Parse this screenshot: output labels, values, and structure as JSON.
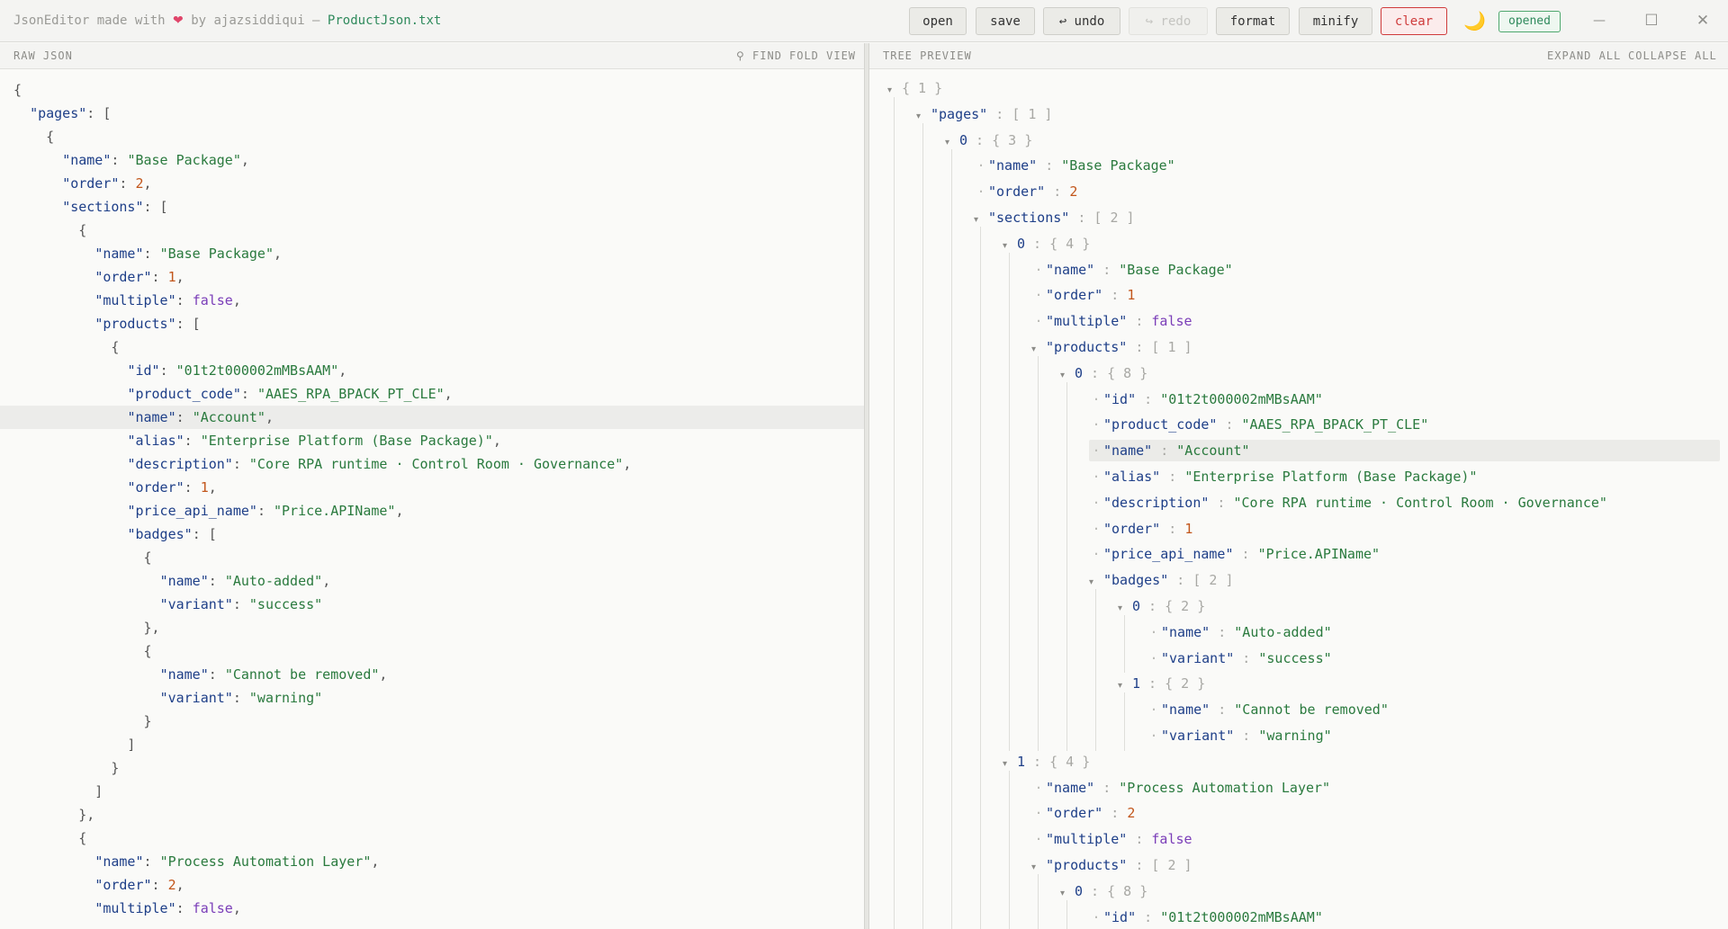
{
  "titlebar": {
    "app": "JsonEditor made with",
    "heart": "❤",
    "by": "by ajazsiddiqui —",
    "file": "ProductJson.txt",
    "buttons": {
      "open": "open",
      "save": "save",
      "undo": "↩ undo",
      "redo": "↪ redo",
      "format": "format",
      "minify": "minify",
      "clear": "clear"
    },
    "theme_icon": "🌙",
    "status": "opened",
    "window": {
      "minimize": "—",
      "maximize": "☐",
      "close": "✕"
    }
  },
  "raw_pane": {
    "label": "RAW JSON",
    "find": "⚲ FIND",
    "fold": "FOLD VIEW",
    "lines": [
      [
        {
          "t": "p",
          "v": "{"
        }
      ],
      [
        {
          "t": "p",
          "v": "  "
        },
        {
          "t": "k",
          "v": "\"pages\""
        },
        {
          "t": "p",
          "v": ": ["
        }
      ],
      [
        {
          "t": "p",
          "v": "    {"
        }
      ],
      [
        {
          "t": "p",
          "v": "      "
        },
        {
          "t": "k",
          "v": "\"name\""
        },
        {
          "t": "p",
          "v": ": "
        },
        {
          "t": "s",
          "v": "\"Base Package\""
        },
        {
          "t": "p",
          "v": ","
        }
      ],
      [
        {
          "t": "p",
          "v": "      "
        },
        {
          "t": "k",
          "v": "\"order\""
        },
        {
          "t": "p",
          "v": ": "
        },
        {
          "t": "n",
          "v": "2"
        },
        {
          "t": "p",
          "v": ","
        }
      ],
      [
        {
          "t": "p",
          "v": "      "
        },
        {
          "t": "k",
          "v": "\"sections\""
        },
        {
          "t": "p",
          "v": ": ["
        }
      ],
      [
        {
          "t": "p",
          "v": "        {"
        }
      ],
      [
        {
          "t": "p",
          "v": "          "
        },
        {
          "t": "k",
          "v": "\"name\""
        },
        {
          "t": "p",
          "v": ": "
        },
        {
          "t": "s",
          "v": "\"Base Package\""
        },
        {
          "t": "p",
          "v": ","
        }
      ],
      [
        {
          "t": "p",
          "v": "          "
        },
        {
          "t": "k",
          "v": "\"order\""
        },
        {
          "t": "p",
          "v": ": "
        },
        {
          "t": "n",
          "v": "1"
        },
        {
          "t": "p",
          "v": ","
        }
      ],
      [
        {
          "t": "p",
          "v": "          "
        },
        {
          "t": "k",
          "v": "\"multiple\""
        },
        {
          "t": "p",
          "v": ": "
        },
        {
          "t": "b",
          "v": "false"
        },
        {
          "t": "p",
          "v": ","
        }
      ],
      [
        {
          "t": "p",
          "v": "          "
        },
        {
          "t": "k",
          "v": "\"products\""
        },
        {
          "t": "p",
          "v": ": ["
        }
      ],
      [
        {
          "t": "p",
          "v": "            {"
        }
      ],
      [
        {
          "t": "p",
          "v": "              "
        },
        {
          "t": "k",
          "v": "\"id\""
        },
        {
          "t": "p",
          "v": ": "
        },
        {
          "t": "s",
          "v": "\"01t2t000002mMBsAAM\""
        },
        {
          "t": "p",
          "v": ","
        }
      ],
      [
        {
          "t": "p",
          "v": "              "
        },
        {
          "t": "k",
          "v": "\"product_code\""
        },
        {
          "t": "p",
          "v": ": "
        },
        {
          "t": "s",
          "v": "\"AAES_RPA_BPACK_PT_CLE\""
        },
        {
          "t": "p",
          "v": ","
        }
      ],
      [
        {
          "t": "p",
          "v": "              "
        },
        {
          "t": "k",
          "v": "\"name\""
        },
        {
          "t": "p",
          "v": ": "
        },
        {
          "t": "s",
          "v": "\"Account\""
        },
        {
          "t": "p",
          "v": ","
        }
      ],
      [
        {
          "t": "p",
          "v": "              "
        },
        {
          "t": "k",
          "v": "\"alias\""
        },
        {
          "t": "p",
          "v": ": "
        },
        {
          "t": "s",
          "v": "\"Enterprise Platform (Base Package)\""
        },
        {
          "t": "p",
          "v": ","
        }
      ],
      [
        {
          "t": "p",
          "v": "              "
        },
        {
          "t": "k",
          "v": "\"description\""
        },
        {
          "t": "p",
          "v": ": "
        },
        {
          "t": "s",
          "v": "\"Core RPA runtime · Control Room · Governance\""
        },
        {
          "t": "p",
          "v": ","
        }
      ],
      [
        {
          "t": "p",
          "v": "              "
        },
        {
          "t": "k",
          "v": "\"order\""
        },
        {
          "t": "p",
          "v": ": "
        },
        {
          "t": "n",
          "v": "1"
        },
        {
          "t": "p",
          "v": ","
        }
      ],
      [
        {
          "t": "p",
          "v": "              "
        },
        {
          "t": "k",
          "v": "\"price_api_name\""
        },
        {
          "t": "p",
          "v": ": "
        },
        {
          "t": "s",
          "v": "\"Price.APIName\""
        },
        {
          "t": "p",
          "v": ","
        }
      ],
      [
        {
          "t": "p",
          "v": "              "
        },
        {
          "t": "k",
          "v": "\"badges\""
        },
        {
          "t": "p",
          "v": ": ["
        }
      ],
      [
        {
          "t": "p",
          "v": "                {"
        }
      ],
      [
        {
          "t": "p",
          "v": "                  "
        },
        {
          "t": "k",
          "v": "\"name\""
        },
        {
          "t": "p",
          "v": ": "
        },
        {
          "t": "s",
          "v": "\"Auto-added\""
        },
        {
          "t": "p",
          "v": ","
        }
      ],
      [
        {
          "t": "p",
          "v": "                  "
        },
        {
          "t": "k",
          "v": "\"variant\""
        },
        {
          "t": "p",
          "v": ": "
        },
        {
          "t": "s",
          "v": "\"success\""
        }
      ],
      [
        {
          "t": "p",
          "v": "                },"
        }
      ],
      [
        {
          "t": "p",
          "v": "                {"
        }
      ],
      [
        {
          "t": "p",
          "v": "                  "
        },
        {
          "t": "k",
          "v": "\"name\""
        },
        {
          "t": "p",
          "v": ": "
        },
        {
          "t": "s",
          "v": "\"Cannot be removed\""
        },
        {
          "t": "p",
          "v": ","
        }
      ],
      [
        {
          "t": "p",
          "v": "                  "
        },
        {
          "t": "k",
          "v": "\"variant\""
        },
        {
          "t": "p",
          "v": ": "
        },
        {
          "t": "s",
          "v": "\"warning\""
        }
      ],
      [
        {
          "t": "p",
          "v": "                }"
        }
      ],
      [
        {
          "t": "p",
          "v": "              ]"
        }
      ],
      [
        {
          "t": "p",
          "v": "            }"
        }
      ],
      [
        {
          "t": "p",
          "v": "          ]"
        }
      ],
      [
        {
          "t": "p",
          "v": "        },"
        }
      ],
      [
        {
          "t": "p",
          "v": "        {"
        }
      ],
      [
        {
          "t": "p",
          "v": "          "
        },
        {
          "t": "k",
          "v": "\"name\""
        },
        {
          "t": "p",
          "v": ": "
        },
        {
          "t": "s",
          "v": "\"Process Automation Layer\""
        },
        {
          "t": "p",
          "v": ","
        }
      ],
      [
        {
          "t": "p",
          "v": "          "
        },
        {
          "t": "k",
          "v": "\"order\""
        },
        {
          "t": "p",
          "v": ": "
        },
        {
          "t": "n",
          "v": "2"
        },
        {
          "t": "p",
          "v": ","
        }
      ],
      [
        {
          "t": "p",
          "v": "          "
        },
        {
          "t": "k",
          "v": "\"multiple\""
        },
        {
          "t": "p",
          "v": ": "
        },
        {
          "t": "b",
          "v": "false"
        },
        {
          "t": "p",
          "v": ","
        }
      ]
    ]
  },
  "tree_pane": {
    "label": "TREE PREVIEW",
    "expand": "EXPAND ALL",
    "collapse": "COLLAPSE ALL",
    "nodes": [
      {
        "d": 0,
        "c": true,
        "meta": "{ 1 }"
      },
      {
        "d": 1,
        "c": true,
        "key": "\"pages\"",
        "meta": "[ 1 ]"
      },
      {
        "d": 2,
        "c": true,
        "idx": "0",
        "meta": "{ 3 }"
      },
      {
        "d": 3,
        "key": "\"name\"",
        "val": "\"Base Package\"",
        "t": "s"
      },
      {
        "d": 3,
        "key": "\"order\"",
        "val": "2",
        "t": "n"
      },
      {
        "d": 3,
        "c": true,
        "key": "\"sections\"",
        "meta": "[ 2 ]"
      },
      {
        "d": 4,
        "c": true,
        "idx": "0",
        "meta": "{ 4 }"
      },
      {
        "d": 5,
        "key": "\"name\"",
        "val": "\"Base Package\"",
        "t": "s"
      },
      {
        "d": 5,
        "key": "\"order\"",
        "val": "1",
        "t": "n"
      },
      {
        "d": 5,
        "key": "\"multiple\"",
        "val": "false",
        "t": "b"
      },
      {
        "d": 5,
        "c": true,
        "key": "\"products\"",
        "meta": "[ 1 ]"
      },
      {
        "d": 6,
        "c": true,
        "idx": "0",
        "meta": "{ 8 }"
      },
      {
        "d": 7,
        "key": "\"id\"",
        "val": "\"01t2t000002mMBsAAM\"",
        "t": "s"
      },
      {
        "d": 7,
        "key": "\"product_code\"",
        "val": "\"AAES_RPA_BPACK_PT_CLE\"",
        "t": "s"
      },
      {
        "d": 7,
        "key": "\"name\"",
        "val": "\"Account\"",
        "t": "s",
        "hl": true
      },
      {
        "d": 7,
        "key": "\"alias\"",
        "val": "\"Enterprise Platform (Base Package)\"",
        "t": "s"
      },
      {
        "d": 7,
        "key": "\"description\"",
        "val": "\"Core RPA runtime · Control Room · Governance\"",
        "t": "s"
      },
      {
        "d": 7,
        "key": "\"order\"",
        "val": "1",
        "t": "n"
      },
      {
        "d": 7,
        "key": "\"price_api_name\"",
        "val": "\"Price.APIName\"",
        "t": "s"
      },
      {
        "d": 7,
        "c": true,
        "key": "\"badges\"",
        "meta": "[ 2 ]"
      },
      {
        "d": 8,
        "c": true,
        "idx": "0",
        "meta": "{ 2 }"
      },
      {
        "d": 9,
        "key": "\"name\"",
        "val": "\"Auto-added\"",
        "t": "s"
      },
      {
        "d": 9,
        "key": "\"variant\"",
        "val": "\"success\"",
        "t": "s"
      },
      {
        "d": 8,
        "c": true,
        "idx": "1",
        "meta": "{ 2 }"
      },
      {
        "d": 9,
        "key": "\"name\"",
        "val": "\"Cannot be removed\"",
        "t": "s"
      },
      {
        "d": 9,
        "key": "\"variant\"",
        "val": "\"warning\"",
        "t": "s"
      },
      {
        "d": 4,
        "c": true,
        "idx": "1",
        "meta": "{ 4 }"
      },
      {
        "d": 5,
        "key": "\"name\"",
        "val": "\"Process Automation Layer\"",
        "t": "s"
      },
      {
        "d": 5,
        "key": "\"order\"",
        "val": "2",
        "t": "n"
      },
      {
        "d": 5,
        "key": "\"multiple\"",
        "val": "false",
        "t": "b"
      },
      {
        "d": 5,
        "c": true,
        "key": "\"products\"",
        "meta": "[ 2 ]"
      },
      {
        "d": 6,
        "c": true,
        "idx": "0",
        "meta": "{ 8 }"
      },
      {
        "d": 7,
        "key": "\"id\"",
        "val": "\"01t2t000002mMBsAAM\"",
        "t": "s"
      }
    ]
  }
}
